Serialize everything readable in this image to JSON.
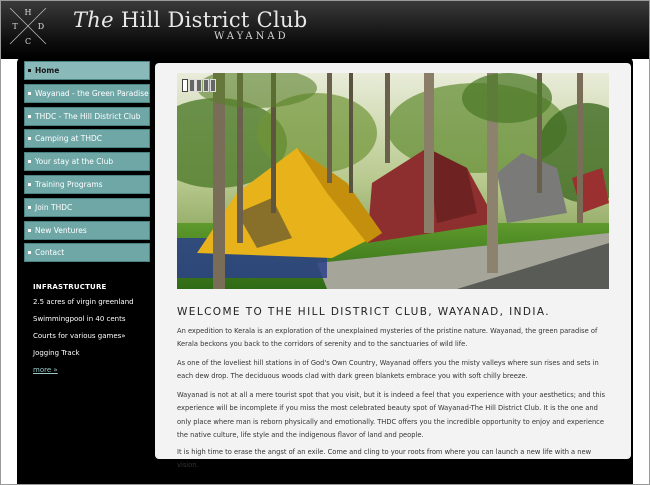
{
  "brand": {
    "monogram": [
      "H",
      "T",
      "D",
      "C"
    ],
    "title_prefix": "The",
    "title_main": "Hill District Club",
    "subtitle": "WAYANAD",
    "accent": "#6fa7a7"
  },
  "nav": {
    "items": [
      {
        "label": "Home",
        "active": true
      },
      {
        "label": "Wayanad - the Green Paradise"
      },
      {
        "label": "THDC - The Hill District Club"
      },
      {
        "label": "Camping at THDC"
      },
      {
        "label": "Your stay at the Club"
      },
      {
        "label": "Training Programs"
      },
      {
        "label": "Join THDC"
      },
      {
        "label": "New Ventures"
      },
      {
        "label": "Contact"
      }
    ]
  },
  "infrastructure": {
    "title": "INFRASTRUCTURE",
    "items": [
      "2.5 acres of virgin greenland",
      "Swimmingpool in 40 cents",
      "Courts for various games»",
      "Jogging Track"
    ],
    "more": "more »"
  },
  "slider": {
    "slide_count": 5,
    "current": 1,
    "image": "camping-tents-in-forest"
  },
  "welcome": {
    "heading": "WELCOME TO THE HILL DISTRICT CLUB, WAYANAD, INDIA.",
    "paragraphs": [
      "An expedition to Kerala is an exploration of the unexplained mysteries of the pristine nature. Wayanad, the green paradise of Kerala beckons you back to the corridors of serenity and to the sanctuaries of wild life.",
      "As one of the loveliest hill stations in of God's Own Country, Wayanad offers you the misty valleys where sun rises and sets in each dew drop. The deciduous woods clad with dark green blankets embrace you with soft chilly breeze.",
      "Wayanad is not at all a mere tourist spot that you visit, but it is indeed a feel that you experience with your aesthetics; and this experience will be incomplete if you miss the most celebrated beauty spot of Wayanad-The Hill District Club. It is the one and only place where man is reborn physically and emotionally. THDC offers you the incredible opportunity to enjoy and experience the native culture, life style and the indigenous flavor of land and people.",
      "It is high time to erase the angst of an exile. Come and cling to your roots from where you can launch a new life with a new vision."
    ]
  }
}
